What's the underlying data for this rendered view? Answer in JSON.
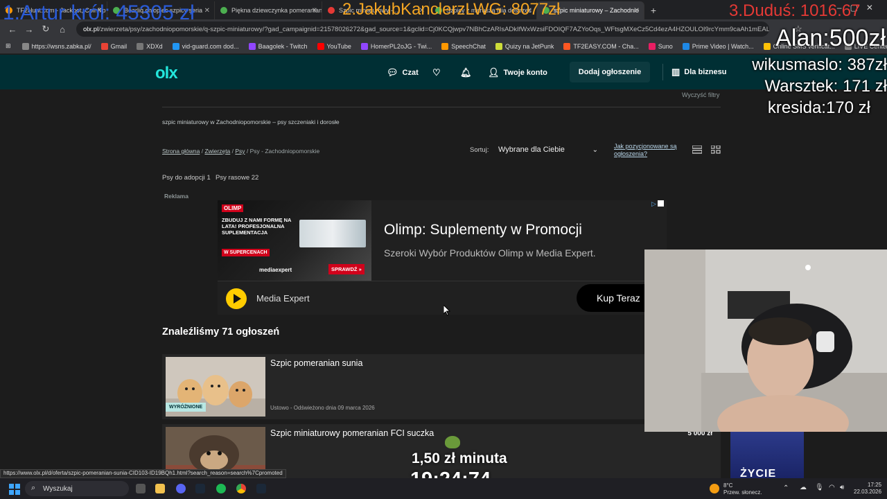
{
  "browser": {
    "tabs": [
      {
        "title": "TF2Hunt.com - Jackpot, Coinflip",
        "color": "#ff9800"
      },
      {
        "title": "Bearliq chłopiec szpicy seria",
        "color": "#4caf50"
      },
      {
        "title": "Piękna dziewczynka pomeranian",
        "color": "#4caf50"
      },
      {
        "title": "Szpic miniaturowy - ...",
        "color": "#e53935"
      },
      {
        "title": "Szpicy z maruszą filia dostrzec",
        "color": "#4caf50"
      },
      {
        "title": "szpic miniaturowy – Zachodnio",
        "color": "#4caf50"
      }
    ],
    "new_tab": "+",
    "url_domain": "olx.pl",
    "url_path": "/zwierzeta/psy/zachodniopomorskie/q-szpic-miniaturowy/?gad_campaignid=21578026272&gad_source=1&gclid=Cj0KCQjwpv7NBhCzARIsADkIfWxWzsiFDOIQF7AZYoOqs_WFtsgMXeCz5Cd4ezA4HZOULOI9rcYmm9caAh1mEALw_wc",
    "bookmarks": [
      {
        "label": "https://wsns.zabka.pl/",
        "color": "#888"
      },
      {
        "label": "Gmail",
        "color": "#ea4335"
      },
      {
        "label": "XDXd",
        "color": "#777"
      },
      {
        "label": "vid-guard.com dod...",
        "color": "#2196f3"
      },
      {
        "label": "Baagolek - Twitch",
        "color": "#9146ff"
      },
      {
        "label": "YouTube",
        "color": "#ff0000"
      },
      {
        "label": "HomerPL2oJG - Twi...",
        "color": "#9146ff"
      },
      {
        "label": "SpeechChat",
        "color": "#ff9800"
      },
      {
        "label": "Quizy na JetPunk",
        "color": "#cddc39"
      },
      {
        "label": "TF2EASY.COM - Cha...",
        "color": "#ff5722"
      },
      {
        "label": "Suno",
        "color": "#e91e63"
      },
      {
        "label": "Prime Video | Watch...",
        "color": "#1e88e5"
      },
      {
        "label": "Online SMS verificat...",
        "color": "#ffc107"
      },
      {
        "label": "LIVE Center",
        "color": "#888"
      }
    ]
  },
  "olx": {
    "logo": "olx",
    "header": {
      "chat": "Czat",
      "account": "Twoje konto",
      "add_listing": "Dodaj ogłoszenie",
      "business": "Dla biznesu"
    },
    "clear_filters": "Wyczyść filtry",
    "page_heading": "szpic miniaturowy w Zachodniopomorskie – psy szczeniaki i dorosłe",
    "breadcrumb": {
      "home": "Strona główna",
      "sep1": " / ",
      "animals": "Zwierzęta",
      "sep2": " / ",
      "dogs": "Psy",
      "rest": " / Psy - Zachodniopomorskie"
    },
    "sort_label": "Sortuj:",
    "sort_value": "Wybrane dla Ciebie",
    "positioning_link_1": "Jak pozycjonowane są",
    "positioning_link_2": "ogłoszenia?",
    "categories": [
      {
        "label": "Psy do adopcji",
        "count": "1"
      },
      {
        "label": "Psy rasowe",
        "count": "22"
      }
    ],
    "ad_label": "Reklama",
    "found_text": "Znaleźliśmy 71 ogłoszeń",
    "listings": [
      {
        "title": "Szpic pomeranian sunia",
        "meta": "Ustowo - Odświeżono dnia 09 marca 2026",
        "badge": "WYRÓŻNIONE",
        "price": ""
      },
      {
        "title": "Szpic miniaturowy pomeranian FCI suczka",
        "meta": "",
        "badge": "",
        "price": "5 000 zł"
      }
    ]
  },
  "advert": {
    "brand_tag": "OLIMP",
    "slogan": "ZBUDUJ Z NAMI FORMĘ NA LATA! PROFESJONALNA SUPLEMENTACJA",
    "red_tag": "W SUPERCENACH",
    "retailer_logo": "mediaexpert",
    "cta_small": "SPRAWDŹ »",
    "title": "Olimp: Suplementy w Promocji",
    "subtitle": "Szeroki Wybór Produktów Olimp w Media Expert.",
    "advertiser": "Media Expert",
    "cta": "Kup Teraz"
  },
  "stream_overlay": {
    "top1": "1.Artur król: 45305 zł",
    "top2": "2.JakubKanclerzLWG: 8077zł",
    "top3": "3.Duduś: 1016.67",
    "donors": [
      {
        "text": "Alan:500zł",
        "size": "big"
      },
      {
        "text": "wikusmaslo: 387zł",
        "size": "normal"
      },
      {
        "text": "Warsztek: 171 zł",
        "size": "normal"
      },
      {
        "text": "kresida:170 zł",
        "size": "normal"
      }
    ],
    "rate": "1,50 zł minuta",
    "timer": "19:24:74",
    "webcam_poster": "ŻYCIE"
  },
  "status_url": "https://www.olx.pl/d/oferta/szpic-pomeranian-sunia-CID103-ID19BQh1.html?search_reason=search%7Cpromoted",
  "taskbar": {
    "search": "Wyszukaj",
    "weather_temp": "8°C",
    "weather_desc": "Przew. słonecz.",
    "time": "17:25",
    "date": "22.03.2026"
  }
}
